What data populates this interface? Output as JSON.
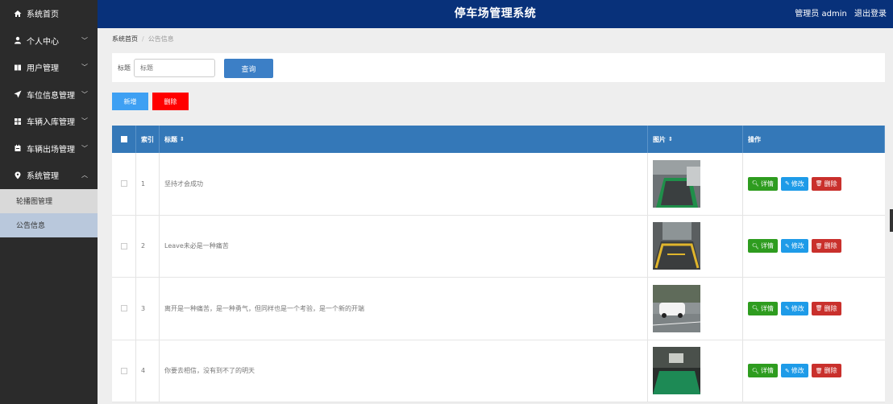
{
  "header": {
    "title": "停车场管理系统",
    "user_label": "管理员 admin",
    "logout_label": "退出登录"
  },
  "sidebar": {
    "items": [
      {
        "label": "系统首页",
        "icon": "home-icon"
      },
      {
        "label": "个人中心",
        "icon": "user-icon"
      },
      {
        "label": "用户管理",
        "icon": "book-icon"
      },
      {
        "label": "车位信息管理",
        "icon": "paper-plane-icon"
      },
      {
        "label": "车辆入库管理",
        "icon": "grid-icon"
      },
      {
        "label": "车辆出场管理",
        "icon": "calendar-icon"
      },
      {
        "label": "系统管理",
        "icon": "map-pin-icon"
      }
    ],
    "sub_items": [
      {
        "label": "轮播图管理"
      },
      {
        "label": "公告信息"
      }
    ]
  },
  "breadcrumb": {
    "home": "系统首页",
    "current": "公告信息"
  },
  "search": {
    "label": "标题",
    "placeholder": "标题",
    "button": "查询"
  },
  "actions": {
    "add": "新增",
    "delete": "删除"
  },
  "table": {
    "headers": {
      "index": "索引",
      "title": "标题",
      "image": "图片",
      "ops": "操作"
    },
    "rows": [
      {
        "index": "1",
        "title": "坚持才会成功"
      },
      {
        "index": "2",
        "title": "Leave未必是一种痛苦"
      },
      {
        "index": "3",
        "title": "离开是一种痛苦，是一种勇气，但同样也是一个考验，是一个新的开端"
      },
      {
        "index": "4",
        "title": "你要去相信，没有到不了的明天"
      }
    ],
    "op_labels": {
      "detail": "详情",
      "edit": "修改",
      "remove": "删除"
    }
  },
  "colors": {
    "header_bg": "#08317a",
    "sidebar_bg": "#2b2b2b",
    "table_head_bg": "#3478b8",
    "detail": "#2e9c1f",
    "edit": "#1e9be8",
    "remove": "#c9302c"
  }
}
